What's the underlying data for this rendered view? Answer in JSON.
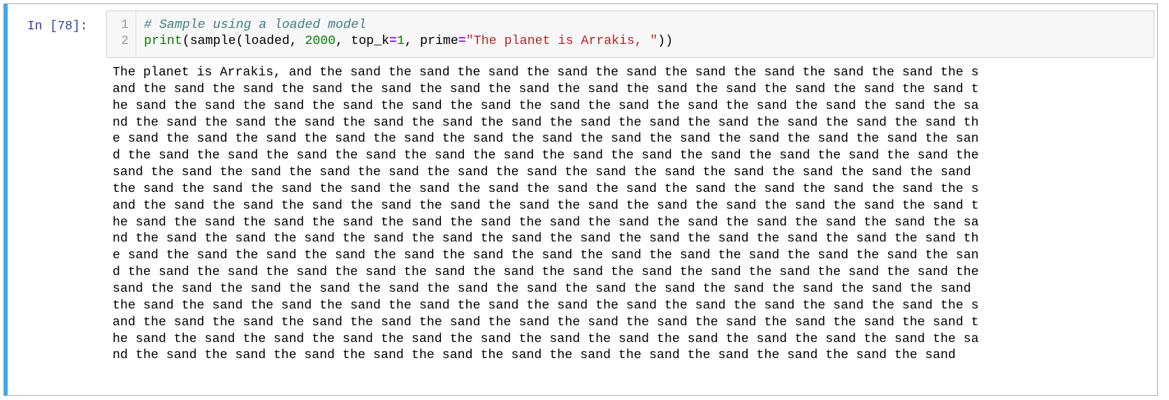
{
  "cell": {
    "prompt": "In [78]:",
    "line_numbers": [
      "1",
      "2"
    ],
    "code": {
      "line1_comment": "# Sample using a loaded model",
      "line2": {
        "fn": "print",
        "p1": "(sample(loaded, ",
        "num1": "2000",
        "p2": ", top_k",
        "op1": "=",
        "num2": "1",
        "p3": ", prime",
        "op2": "=",
        "str": "\"The planet is Arrakis, \"",
        "p4": "))"
      }
    },
    "accent_color": "#42a5f5",
    "output_lines": [
      "The planet is Arrakis, and the sand the sand the sand the sand the sand the sand the sand the sand the sand the s",
      "and the sand the sand the sand the sand the sand the sand the sand the sand the sand the sand the sand the sand t",
      "he sand the sand the sand the sand the sand the sand the sand the sand the sand the sand the sand the sand the sa",
      "nd the sand the sand the sand the sand the sand the sand the sand the sand the sand the sand the sand the sand th",
      "e sand the sand the sand the sand the sand the sand the sand the sand the sand the sand the sand the sand the san",
      "d the sand the sand the sand the sand the sand the sand the sand the sand the sand the sand the sand the sand the",
      "sand the sand the sand the sand the sand the sand the sand the sand the sand the sand the sand the sand the sand ",
      "the sand the sand the sand the sand the sand the sand the sand the sand the sand the sand the sand the sand the s",
      "and the sand the sand the sand the sand the sand the sand the sand the sand the sand the sand the sand the sand t",
      "he sand the sand the sand the sand the sand the sand the sand the sand the sand the sand the sand the sand the sa",
      "nd the sand the sand the sand the sand the sand the sand the sand the sand the sand the sand the sand the sand th",
      "e sand the sand the sand the sand the sand the sand the sand the sand the sand the sand the sand the sand the san",
      "d the sand the sand the sand the sand the sand the sand the sand the sand the sand the sand the sand the sand the",
      "sand the sand the sand the sand the sand the sand the sand the sand the sand the sand the sand the sand the sand ",
      "the sand the sand the sand the sand the sand the sand the sand the sand the sand the sand the sand the sand the s",
      "and the sand the sand the sand the sand the sand the sand the sand the sand the sand the sand the sand the sand t",
      "he sand the sand the sand the sand the sand the sand the sand the sand the sand the sand the sand the sand the sa",
      "nd the sand the sand the sand the sand the sand the sand the sand the sand the sand the sand the sand the sand"
    ]
  }
}
